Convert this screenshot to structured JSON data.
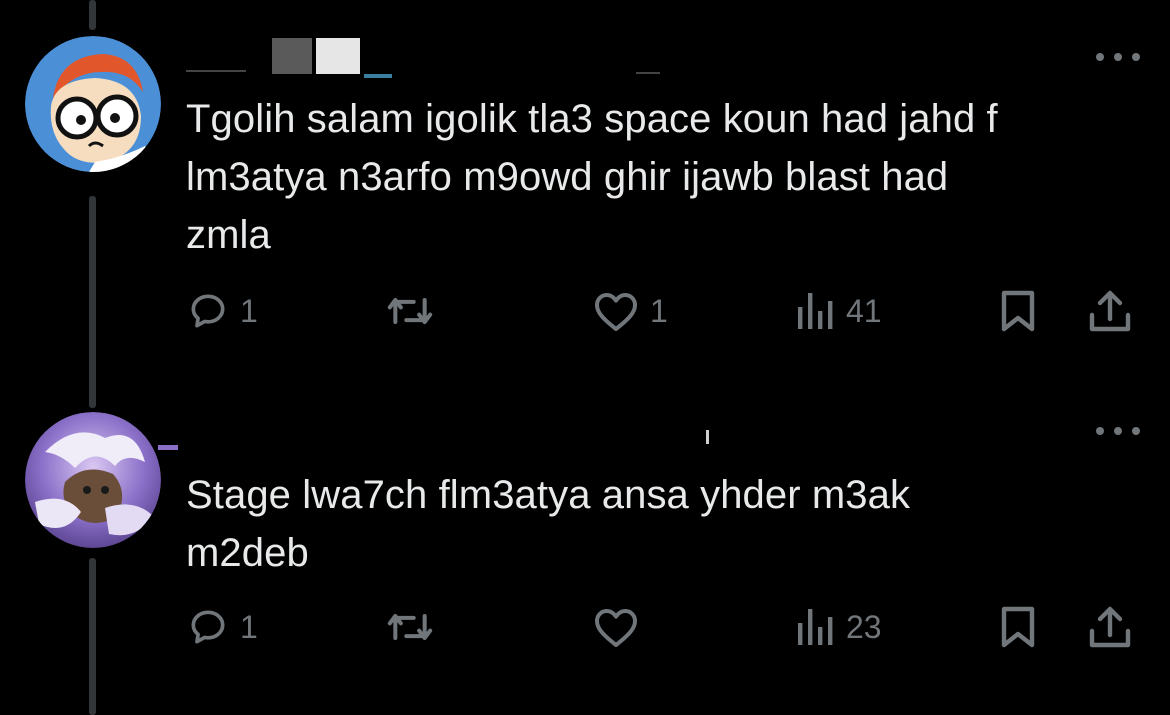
{
  "thread": [
    {
      "avatar": "dexter-cartoon-avatar",
      "text": "Tgolih salam igolik tla3 space koun had jahd f\nlm3atya n3arfo m9owd ghir ijawb blast had\nzmla",
      "actions": {
        "reply_count": "1",
        "retweet_count": "",
        "like_count": "1",
        "views_count": "41"
      }
    },
    {
      "avatar": "anime-character-avatar",
      "text": "Stage lwa7ch flm3atya ansa yhder m3ak\nm2deb",
      "actions": {
        "reply_count": "1",
        "retweet_count": "",
        "like_count": "",
        "views_count": "23"
      }
    }
  ],
  "icons": {
    "reply": "reply-bubble-icon",
    "retweet": "retweet-arrows-icon",
    "like": "heart-icon",
    "views": "views-bar-chart-icon",
    "bookmark": "bookmark-icon",
    "share": "share-upload-icon",
    "more": "more-dots-icon"
  },
  "colors": {
    "background": "#000000",
    "text": "#e7e9ea",
    "muted": "#71767b",
    "thread_line": "#333639",
    "avatar1_bg": "#4b8fd6",
    "avatar2_bg": "#8a6fc8"
  }
}
